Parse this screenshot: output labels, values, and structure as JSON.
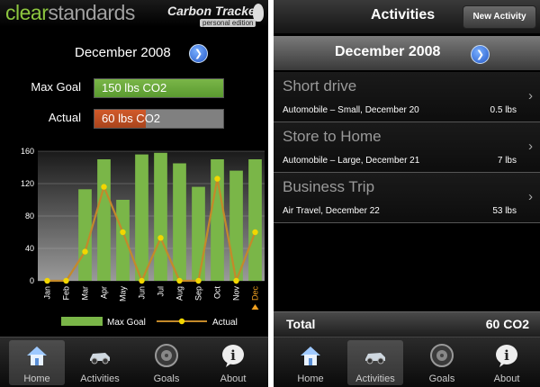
{
  "home": {
    "brand": {
      "part1": "clear",
      "part2": "standards"
    },
    "badge": {
      "title": "Carbon Tracker",
      "subtitle": "personal edition"
    },
    "month": "December 2008",
    "max_goal": {
      "label": "Max Goal",
      "value_text": "150 lbs CO2",
      "fill_fraction": 1.0
    },
    "actual": {
      "label": "Actual",
      "value_text": "60 lbs CO2",
      "fill_fraction": 0.4
    },
    "colors": {
      "goal": "#7ab648",
      "actual": "#d25a2a",
      "line": "#c4892a",
      "point": "#f2d600",
      "track": "#808080"
    }
  },
  "chart_data": {
    "type": "bar",
    "categories": [
      "Jan",
      "Feb",
      "Mar",
      "Apr",
      "May",
      "Jun",
      "Jul",
      "Aug",
      "Sep",
      "Oct",
      "Nov",
      "Dec"
    ],
    "series": [
      {
        "name": "Max Goal",
        "type": "bar",
        "values": [
          0,
          0,
          113,
          150,
          100,
          156,
          158,
          145,
          116,
          150,
          136,
          150
        ]
      },
      {
        "name": "Actual",
        "type": "line",
        "values": [
          0,
          0,
          36,
          116,
          60,
          0,
          53,
          0,
          0,
          126,
          0,
          60
        ]
      }
    ],
    "yticks": [
      0,
      40,
      80,
      120,
      160
    ],
    "ylim": [
      0,
      160
    ],
    "legend": "bottom",
    "highlight_category": "Dec"
  },
  "activities": {
    "title": "Activities",
    "new_button": "New Activity",
    "month": "December 2008",
    "items": [
      {
        "title": "Short drive",
        "detail": "Automobile – Small, December 20",
        "amount": "0.5 lbs"
      },
      {
        "title": "Store to Home",
        "detail": "Automobile – Large, December 21",
        "amount": "7 lbs"
      },
      {
        "title": "Business Trip",
        "detail": "Air Travel, December 22",
        "amount": "53 lbs"
      }
    ],
    "total_label": "Total",
    "total_value": "60 CO2"
  },
  "tabs": [
    {
      "label": "Home",
      "icon": "house-icon"
    },
    {
      "label": "Activities",
      "icon": "car-icon"
    },
    {
      "label": "Goals",
      "icon": "tire-icon"
    },
    {
      "label": "About",
      "icon": "info-icon"
    }
  ],
  "left_active_tab": "Home",
  "right_active_tab": "Activities"
}
